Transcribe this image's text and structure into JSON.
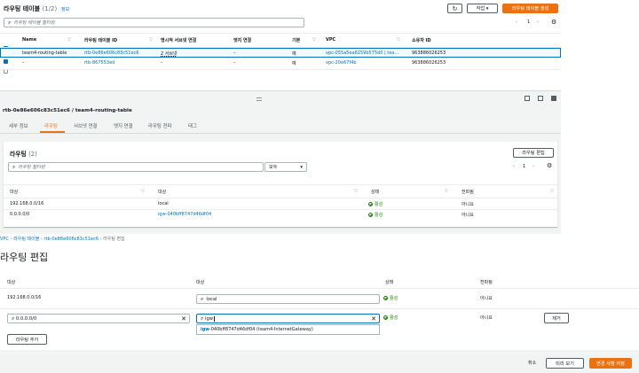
{
  "top": {
    "title": "라우팅 테이블",
    "count": "(1/2)",
    "info_link": "정보",
    "search_placeholder": "라우팅 테이블 필터링",
    "actions_label": "작업",
    "create_label": "라우팅 테이블 생성",
    "page": "1",
    "columns": [
      "Name",
      "라우팅 테이블 ID",
      "명시적 서브넷 연결",
      "엣지 연결",
      "기본",
      "VPC",
      "소유자 ID"
    ],
    "rows": [
      {
        "name": "team4-routing-table",
        "id": "rtb-0e86e606c83c51ec6",
        "subnet": "2 서브넷",
        "edge": "–",
        "main": "예",
        "vpc": "vpc-055a5ea8259b575d0 | tea...",
        "owner": "963886026253"
      },
      {
        "name": "–",
        "id": "rtb-867553ed",
        "subnet": "–",
        "edge": "–",
        "main": "예",
        "vpc": "vpc-20e67f4b",
        "owner": "963886026253"
      }
    ]
  },
  "detail": {
    "title": "rtb-0e86e606c83c51ec6 / team4-routing-table",
    "tabs": [
      "세부 정보",
      "라우팅",
      "서브넷 연결",
      "엣지 연결",
      "라우팅 전파",
      "태그"
    ],
    "routes_title": "라우팅",
    "routes_count": "(2)",
    "edit_label": "라우팅 편집",
    "filter_placeholder": "라우팅 필터링",
    "select_value": "모두",
    "page": "1",
    "columns": [
      "대상",
      "대상",
      "상태",
      "전파됨"
    ],
    "rows": [
      {
        "dest": "192.168.0.0/16",
        "target": "local",
        "status": "활성",
        "prop": "아니요"
      },
      {
        "dest": "0.0.0.0/0",
        "target": "igw-040bff8747d46df04",
        "status": "활성",
        "prop": "아니요"
      }
    ]
  },
  "edit": {
    "breadcrumb": [
      "VPC",
      "라우팅 테이블",
      "rtb-0e86e606c83c51ec6",
      "라우팅 편집"
    ],
    "title": "라우팅 편집",
    "columns": [
      "대상",
      "대상",
      "상태",
      "전파됨"
    ],
    "row1": {
      "dest": "192.168.0.0/16",
      "target": "local",
      "status": "활성",
      "prop": "아니요"
    },
    "row2": {
      "dest": "0.0.0.0/0",
      "target": "igw",
      "status": "활성",
      "prop": "아니요",
      "remove": "제거"
    },
    "suggestion_prefix": "igw",
    "suggestion_rest": "-040bff8747d46df04 (team4-InternetGateway)",
    "add_label": "라우팅 추가",
    "cancel": "취소",
    "preview": "미리 보기",
    "save": "변경 사항 저장"
  }
}
